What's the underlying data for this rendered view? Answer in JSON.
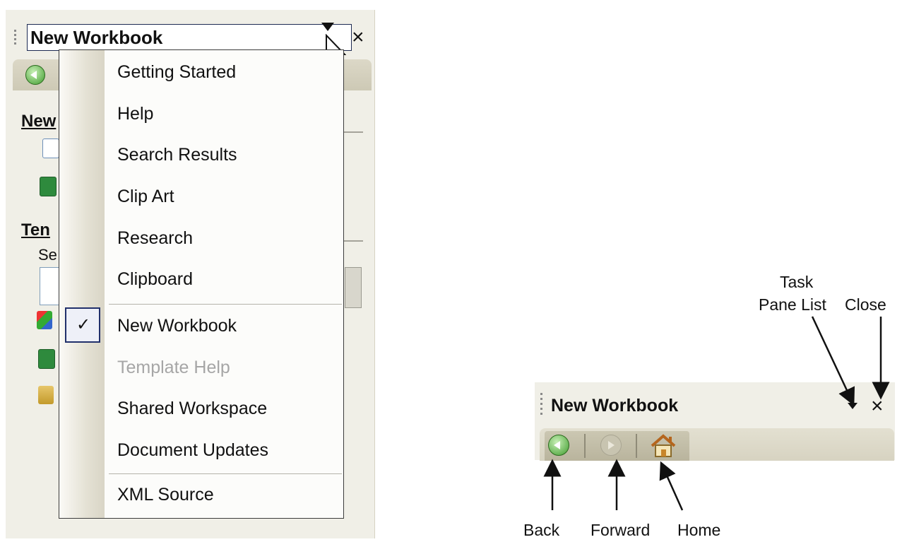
{
  "pane": {
    "title": "New Workbook",
    "close_glyph": "×",
    "side_partial": {
      "new_label": "New",
      "templates_label": "Ten",
      "search_label": "Se"
    },
    "icons": [
      "blank-workbook-icon",
      "existing-workbook-icon",
      "office-online-icon",
      "templates-on-computer-icon",
      "templates-on-website-icon"
    ]
  },
  "menu": {
    "items": [
      {
        "label": "Getting Started",
        "state": "enabled"
      },
      {
        "label": "Help",
        "state": "enabled"
      },
      {
        "label": "Search Results",
        "state": "enabled"
      },
      {
        "label": "Clip Art",
        "state": "enabled"
      },
      {
        "label": "Research",
        "state": "enabled"
      },
      {
        "label": "Clipboard",
        "state": "enabled"
      },
      {
        "label": "New Workbook",
        "state": "checked"
      },
      {
        "label": "Template Help",
        "state": "disabled"
      },
      {
        "label": "Shared Workspace",
        "state": "enabled"
      },
      {
        "label": "Document Updates",
        "state": "enabled"
      },
      {
        "label": "XML Source",
        "state": "enabled"
      }
    ],
    "check_glyph": "✓"
  },
  "diagram": {
    "title": "New Workbook",
    "close_glyph": "×",
    "annotations": {
      "task_pane_list_line1": "Task",
      "task_pane_list_line2": "Pane List",
      "close": "Close",
      "back": "Back",
      "forward": "Forward",
      "home": "Home"
    }
  },
  "colors": {
    "pane_bg": "#f0efe7",
    "menu_border": "#3b3b3b",
    "disabled_text": "#a6a6a6",
    "back_green": "#3f9b2e",
    "check_border": "#21306b"
  }
}
